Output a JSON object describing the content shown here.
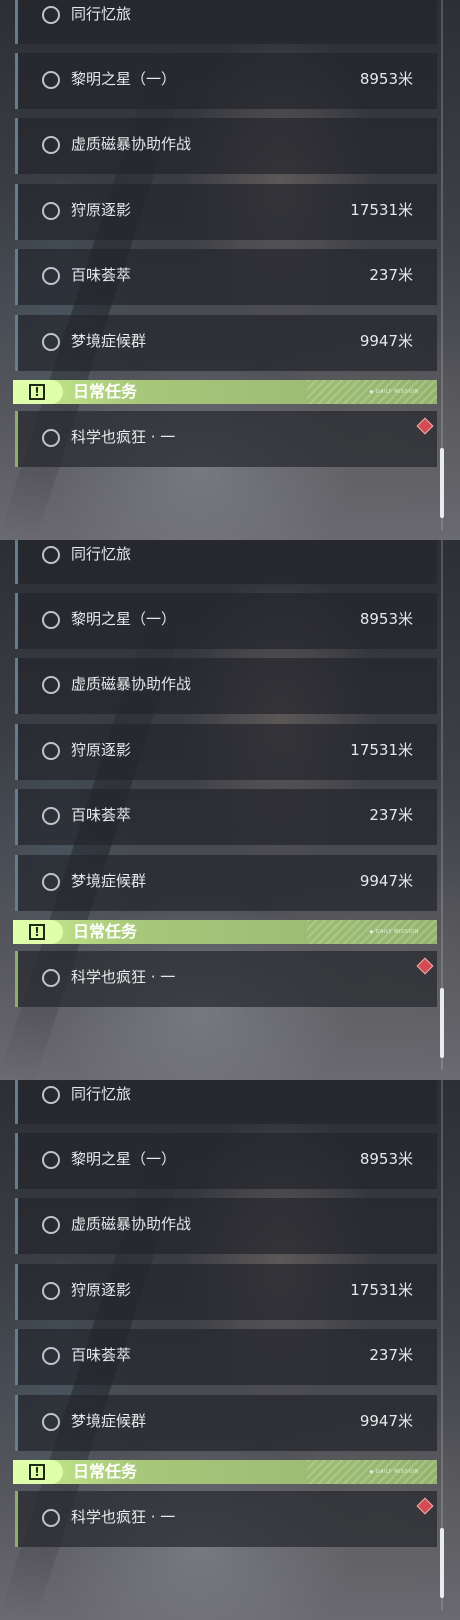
{
  "panels": [
    {
      "tasks": [
        {
          "name": "同行忆旅",
          "distance": ""
        },
        {
          "name": "黎明之星（一）",
          "distance": "8953米"
        },
        {
          "name": "虚质磁暴协助作战",
          "distance": ""
        },
        {
          "name": "狩原逐影",
          "distance": "17531米"
        },
        {
          "name": "百味荟萃",
          "distance": "237米"
        },
        {
          "name": "梦境症候群",
          "distance": "9947米"
        }
      ],
      "daily": {
        "title": "日常任务",
        "tag": "◆ DAILY  MISSION",
        "task": "科学也疯狂 · 一"
      }
    },
    {
      "tasks": [
        {
          "name": "同行忆旅",
          "distance": ""
        },
        {
          "name": "黎明之星（一）",
          "distance": "8953米"
        },
        {
          "name": "虚质磁暴协助作战",
          "distance": ""
        },
        {
          "name": "狩原逐影",
          "distance": "17531米"
        },
        {
          "name": "百味荟萃",
          "distance": "237米"
        },
        {
          "name": "梦境症候群",
          "distance": "9947米"
        }
      ],
      "daily": {
        "title": "日常任务",
        "tag": "◆ DAILY  MISSION",
        "task": "科学也疯狂 · 一"
      }
    },
    {
      "tasks": [
        {
          "name": "同行忆旅",
          "distance": ""
        },
        {
          "name": "黎明之星（一）",
          "distance": "8953米"
        },
        {
          "name": "虚质磁暴协助作战",
          "distance": ""
        },
        {
          "name": "狩原逐影",
          "distance": "17531米"
        },
        {
          "name": "百味荟萃",
          "distance": "237米"
        },
        {
          "name": "梦境症候群",
          "distance": "9947米"
        }
      ],
      "daily": {
        "title": "日常任务",
        "tag": "◆ DAILY  MISSION",
        "task": "科学也疯狂 · 一"
      }
    }
  ],
  "icons": {
    "task_status": "circle-outline-icon",
    "daily_header": "exclamation-box-icon",
    "alert": "red-diamond-icon"
  },
  "colors": {
    "daily_accent": "#c9ec8f",
    "task_border": "#667e8c",
    "alert": "#d24a52"
  }
}
